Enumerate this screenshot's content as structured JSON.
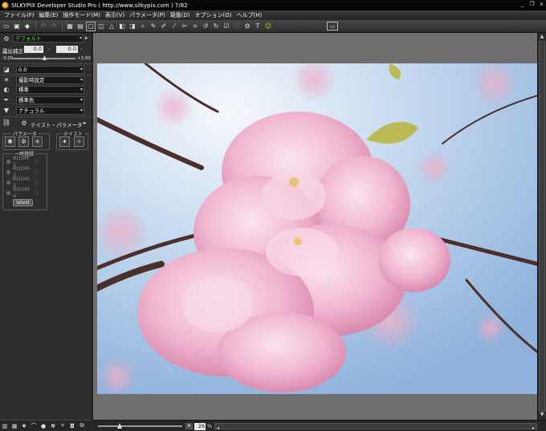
{
  "titlebar": {
    "title": "SILKYPIX Developer Studio Pro ( http://www.silkypix.com )  7/82"
  },
  "window": {
    "minimize": "_",
    "restore": "❐",
    "close": "x"
  },
  "menu": [
    "ファイル(F)",
    "編集(E)",
    "操作モード(M)",
    "表示(V)",
    "パラメータ(P)",
    "現像(D)",
    "オプション(O)",
    "ヘルプ(H)"
  ],
  "panel": {
    "preset_value": "デフォルト",
    "exposure_label": "露出補正",
    "exposure_value": "0.0",
    "exposure_value2": "0.0",
    "exposure_min": "-3.00",
    "exposure_max": "+3.00",
    "contrast_value": "0.0",
    "wb_value": "撮影時設定",
    "tone_value": "標準",
    "color_value": "標準色",
    "sharp_value": "ナチュラル",
    "tab_label": "テイスト・パラメータ",
    "param_group": "パラメータ",
    "taste_group": "テイスト",
    "temp_group": "一時登録",
    "rooms": [
      "ROOM 1",
      "ROOM 2",
      "ROOM 3",
      "ROOM 4"
    ],
    "latest": "latest"
  },
  "status": {
    "zoom": "26",
    "zoom_unit": "%"
  },
  "colors": {
    "sky": "#a8c6e4",
    "canvas": "#6e6e6e",
    "accent_green": "#53e64b"
  }
}
